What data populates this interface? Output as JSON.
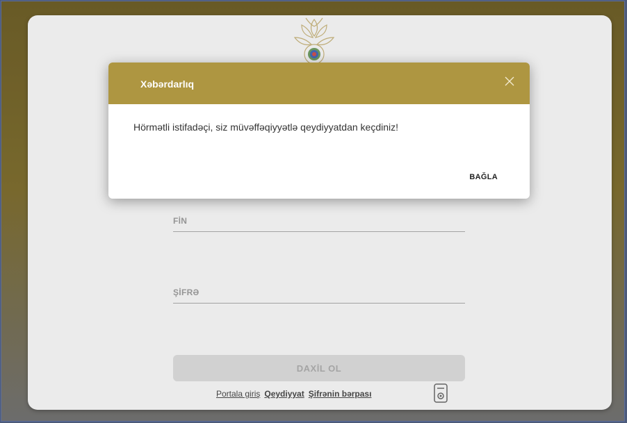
{
  "dialog": {
    "title": "Xəbərdarlıq",
    "message": "Hörmətli istifadəçi, siz müvəffəqiyyətlə qeydiyyatdan keçdiniz!",
    "close_button": "BAĞLA"
  },
  "form": {
    "fin_label": "FİN",
    "password_label": "ŞİFRƏ",
    "login_button": "DAXİL OL"
  },
  "links": {
    "portal_login": "Portala giriş",
    "registration": "Qeydiyyat",
    "password_recovery": "Şifrənin bərpası"
  },
  "colors": {
    "header_gold": "#ae9641",
    "card_bg": "#ebebeb"
  }
}
